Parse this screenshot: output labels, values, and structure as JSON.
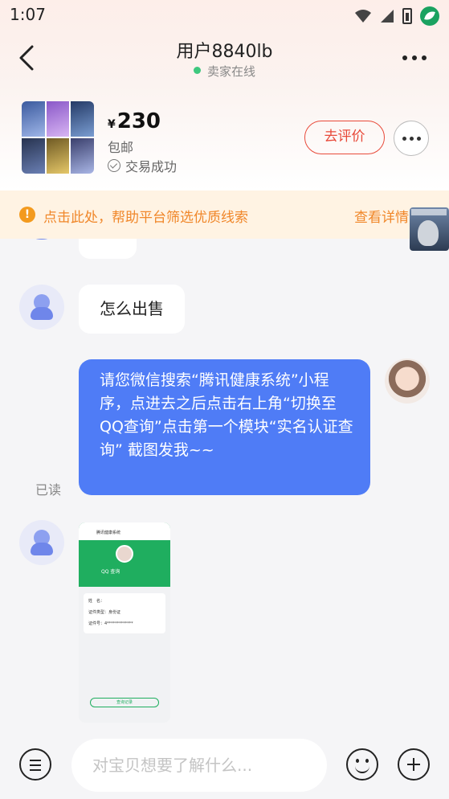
{
  "status_bar": {
    "time": "1:07",
    "icons": [
      "wifi-icon",
      "signal-icon",
      "battery-icon",
      "leaf-app-icon"
    ]
  },
  "header": {
    "title": "用户8840lb",
    "subtitle": "卖家在线",
    "online_color": "#3ec87e"
  },
  "product": {
    "currency": "¥",
    "price": "230",
    "shipping": "包邮",
    "status": "交易成功",
    "review_button": "去评价"
  },
  "notice": {
    "text": "点击此处，帮助平台筛选优质线索",
    "link": "查看详情",
    "color": "#f0872a"
  },
  "messages": [
    {
      "side": "left",
      "text": "怎么出售"
    },
    {
      "side": "right",
      "text": "请您微信搜索“腾讯健康系统”小程序，点进去之后点击右上角“切换至QQ查询”点击第一个模块“实名认证查询” 截图发我~~"
    },
    {
      "side": "left",
      "type": "image"
    }
  ],
  "read_status": "已读",
  "image_message": {
    "top_title": "腾讯健康系统",
    "name_line": "QQ 查询",
    "rows": [
      "姓　名：",
      "证件类型：身份证",
      "证件号：4*************"
    ],
    "button": "查询记录"
  },
  "bottom_bar": {
    "input_placeholder": "对宝贝想要了解什么..."
  },
  "colors": {
    "accent_blue": "#4f7cf6",
    "review_red": "#e84a3a",
    "notice_bg": "#fff3e3"
  }
}
